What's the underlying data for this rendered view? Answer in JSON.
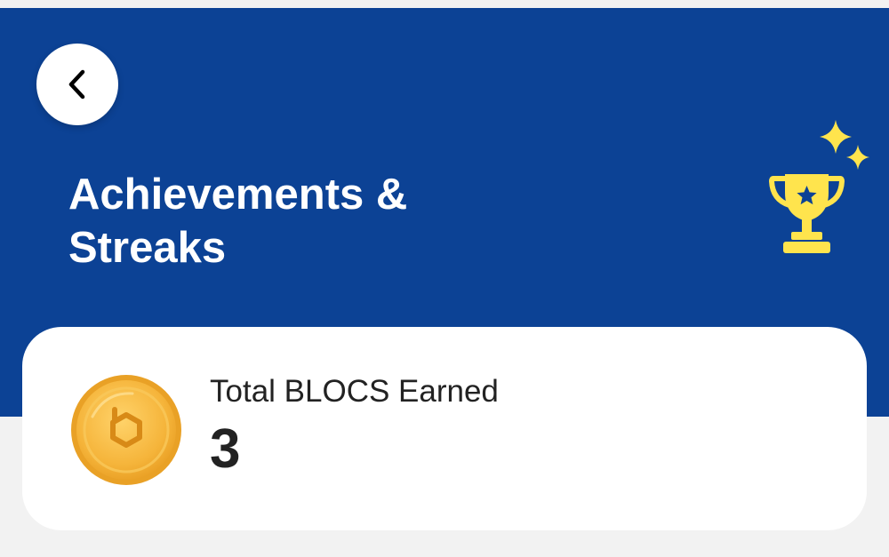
{
  "header": {
    "title_line1": "Achievements &",
    "title_line2": "Streaks",
    "back_icon": "chevron-left-icon",
    "decoration_icon": "trophy-icon",
    "background_color": "#0c4295",
    "accent_color": "#ffe44d"
  },
  "summary_card": {
    "label": "Total BLOCS Earned",
    "value": "3",
    "icon": "bloc-coin-icon",
    "coin_color": "#f2b233"
  }
}
